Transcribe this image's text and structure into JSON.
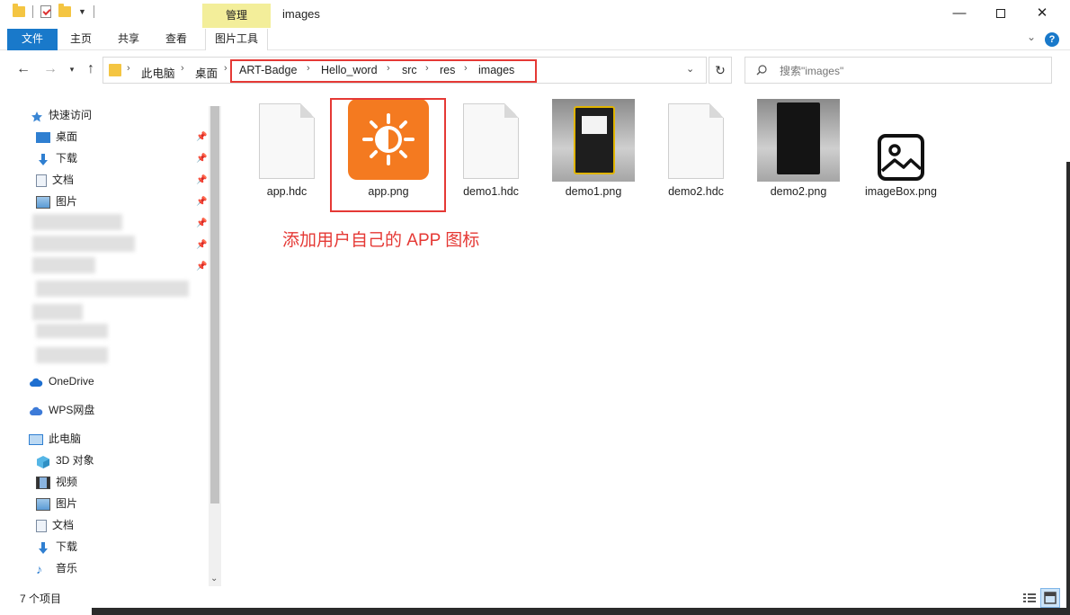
{
  "window": {
    "title": "images",
    "contextual_tab": "管理",
    "controls": {
      "minimize": "—",
      "maximize": "□",
      "close": "✕"
    }
  },
  "ribbon": {
    "file": "文件",
    "home": "主页",
    "share": "共享",
    "view": "查看",
    "picture_tools": "图片工具"
  },
  "address": {
    "crumbs": [
      "此电脑",
      "桌面",
      "ART-Badge",
      "Hello_word",
      "src",
      "res",
      "images"
    ],
    "separator": "›"
  },
  "search": {
    "placeholder": "搜索\"images\""
  },
  "navpane": {
    "quick_access": "快速访问",
    "pinned": [
      "桌面",
      "下载",
      "文档",
      "图片"
    ],
    "onedrive": "OneDrive",
    "wps": "WPS网盘",
    "this_pc": "此电脑",
    "pc_items": [
      "3D 对象",
      "视频",
      "图片",
      "文档",
      "下载",
      "音乐"
    ]
  },
  "files": [
    {
      "name": "app.hdc",
      "type": "document"
    },
    {
      "name": "app.png",
      "type": "app-icon"
    },
    {
      "name": "demo1.hdc",
      "type": "document"
    },
    {
      "name": "demo1.png",
      "type": "photo"
    },
    {
      "name": "demo2.hdc",
      "type": "document"
    },
    {
      "name": "demo2.png",
      "type": "photo"
    },
    {
      "name": "imageBox.png",
      "type": "image-icon"
    }
  ],
  "annotation": "添加用户自己的 APP 图标",
  "status": {
    "item_count": "7 个项目"
  },
  "colors": {
    "accent": "#1979ca",
    "manage_tab": "#f3ee9a",
    "app_icon": "#f47a20",
    "annotation_red": "#e53935",
    "folder_yellow": "#f4c542"
  }
}
